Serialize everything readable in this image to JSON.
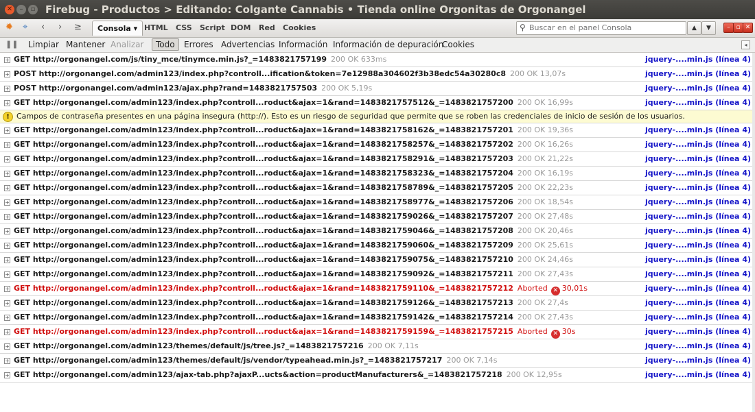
{
  "window": {
    "title": "Firebug - Productos > Editando: Colgante Cannabis • Tienda online Orgonitas de Orgonangel"
  },
  "toolbar": {
    "tabs": [
      {
        "label": "Consola ▾"
      },
      {
        "label": "HTML"
      },
      {
        "label": "CSS"
      },
      {
        "label": "Script"
      },
      {
        "label": "DOM"
      },
      {
        "label": "Red"
      },
      {
        "label": "Cookies"
      }
    ],
    "search_placeholder": "Buscar en el panel Consola"
  },
  "filters": {
    "clear": "Limpiar",
    "keep": "Mantener",
    "analyze": "Analizar",
    "all": "Todo",
    "errors": "Errores",
    "warnings": "Advertencias",
    "info": "Información",
    "debug": "Información de depuración",
    "cookies": "Cookies"
  },
  "log": [
    {
      "req": "GET http://orgonangel.com/js/tiny_mce/tinymce.min.js?_=1483821757199",
      "status": "200 OK 633ms",
      "src": "jquery-....min.js (línea 4)"
    },
    {
      "req": "POST http://orgonangel.com/admin123/index.php?controll...ification&token=7e12988a304602f3b38edc54a30280c8",
      "status": "200 OK 13,07s",
      "src": "jquery-....min.js (línea 4)"
    },
    {
      "req": "POST http://orgonangel.com/admin123/ajax.php?rand=1483821757503",
      "status": "200 OK 5,19s",
      "src": "jquery-....min.js (línea 4)"
    },
    {
      "req": "GET http://orgonangel.com/admin123/index.php?controll...roduct&ajax=1&rand=1483821757512&_=1483821757200",
      "status": "200 OK 16,99s",
      "src": "jquery-....min.js (línea 4)"
    },
    {
      "warning": "Campos de contraseña presentes en una página insegura (http://). Esto es un riesgo de seguridad que permite que se roben las credenciales de inicio de sesión de los usuarios."
    },
    {
      "req": "GET http://orgonangel.com/admin123/index.php?controll...roduct&ajax=1&rand=1483821758162&_=1483821757201",
      "status": "200 OK 19,36s",
      "src": "jquery-....min.js (línea 4)"
    },
    {
      "req": "GET http://orgonangel.com/admin123/index.php?controll...roduct&ajax=1&rand=1483821758257&_=1483821757202",
      "status": "200 OK 16,26s",
      "src": "jquery-....min.js (línea 4)"
    },
    {
      "req": "GET http://orgonangel.com/admin123/index.php?controll...roduct&ajax=1&rand=1483821758291&_=1483821757203",
      "status": "200 OK 21,22s",
      "src": "jquery-....min.js (línea 4)"
    },
    {
      "req": "GET http://orgonangel.com/admin123/index.php?controll...roduct&ajax=1&rand=1483821758323&_=1483821757204",
      "status": "200 OK 16,19s",
      "src": "jquery-....min.js (línea 4)"
    },
    {
      "req": "GET http://orgonangel.com/admin123/index.php?controll...roduct&ajax=1&rand=1483821758789&_=1483821757205",
      "status": "200 OK 22,23s",
      "src": "jquery-....min.js (línea 4)"
    },
    {
      "req": "GET http://orgonangel.com/admin123/index.php?controll...roduct&ajax=1&rand=1483821758977&_=1483821757206",
      "status": "200 OK 18,54s",
      "src": "jquery-....min.js (línea 4)"
    },
    {
      "req": "GET http://orgonangel.com/admin123/index.php?controll...roduct&ajax=1&rand=1483821759026&_=1483821757207",
      "status": "200 OK 27,48s",
      "src": "jquery-....min.js (línea 4)"
    },
    {
      "req": "GET http://orgonangel.com/admin123/index.php?controll...roduct&ajax=1&rand=1483821759046&_=1483821757208",
      "status": "200 OK 20,46s",
      "src": "jquery-....min.js (línea 4)"
    },
    {
      "req": "GET http://orgonangel.com/admin123/index.php?controll...roduct&ajax=1&rand=1483821759060&_=1483821757209",
      "status": "200 OK 25,61s",
      "src": "jquery-....min.js (línea 4)"
    },
    {
      "req": "GET http://orgonangel.com/admin123/index.php?controll...roduct&ajax=1&rand=1483821759075&_=1483821757210",
      "status": "200 OK 24,46s",
      "src": "jquery-....min.js (línea 4)"
    },
    {
      "req": "GET http://orgonangel.com/admin123/index.php?controll...roduct&ajax=1&rand=1483821759092&_=1483821757211",
      "status": "200 OK 27,43s",
      "src": "jquery-....min.js (línea 4)"
    },
    {
      "req": "GET http://orgonangel.com/admin123/index.php?controll...roduct&ajax=1&rand=1483821759110&_=1483821757212",
      "status": "Aborted",
      "time": "30,01s",
      "error": true,
      "src": "jquery-....min.js (línea 4)"
    },
    {
      "req": "GET http://orgonangel.com/admin123/index.php?controll...roduct&ajax=1&rand=1483821759126&_=1483821757213",
      "status": "200 OK 27,4s",
      "src": "jquery-....min.js (línea 4)"
    },
    {
      "req": "GET http://orgonangel.com/admin123/index.php?controll...roduct&ajax=1&rand=1483821759142&_=1483821757214",
      "status": "200 OK 27,43s",
      "src": "jquery-....min.js (línea 4)"
    },
    {
      "req": "GET http://orgonangel.com/admin123/index.php?controll...roduct&ajax=1&rand=1483821759159&_=1483821757215",
      "status": "Aborted",
      "time": "30s",
      "error": true,
      "src": "jquery-....min.js (línea 4)"
    },
    {
      "req": "GET http://orgonangel.com/admin123/themes/default/js/tree.js?_=1483821757216",
      "status": "200 OK 7,11s",
      "src": "jquery-....min.js (línea 4)"
    },
    {
      "req": "GET http://orgonangel.com/admin123/themes/default/js/vendor/typeahead.min.js?_=1483821757217",
      "status": "200 OK 7,14s",
      "src": "jquery-....min.js (línea 4)"
    },
    {
      "req": "GET http://orgonangel.com/admin123/ajax-tab.php?ajaxP...ucts&action=productManufacturers&_=1483821757218",
      "status": "200 OK 12,95s",
      "src": "jquery-....min.js (línea 4)"
    }
  ]
}
